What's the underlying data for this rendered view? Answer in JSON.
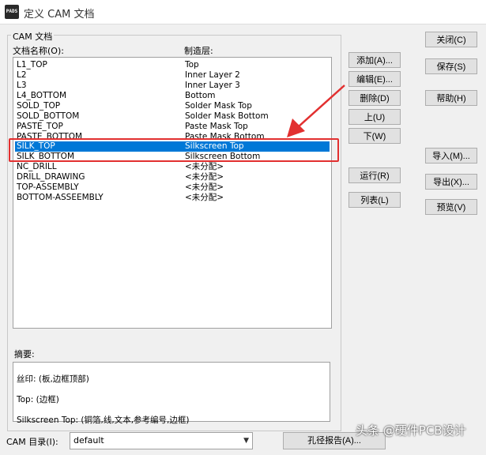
{
  "window": {
    "icon_text": "PADS",
    "title": "定义 CAM 文档"
  },
  "group": {
    "title": "CAM 文档"
  },
  "list": {
    "col_name_header": "文档名称(O):",
    "col_layer_header": "制造层:",
    "rows": [
      {
        "name": "L1_TOP",
        "layer": "Top"
      },
      {
        "name": "L2",
        "layer": "Inner Layer 2"
      },
      {
        "name": "L3",
        "layer": "Inner Layer 3"
      },
      {
        "name": "L4_BOTTOM",
        "layer": "Bottom"
      },
      {
        "name": "SOLD_TOP",
        "layer": "Solder Mask Top"
      },
      {
        "name": "SOLD_BOTTOM",
        "layer": "Solder Mask Bottom"
      },
      {
        "name": "PASTE_TOP",
        "layer": "Paste Mask Top"
      },
      {
        "name": "PASTE_BOTTOM",
        "layer": "Paste Mask Bottom"
      },
      {
        "name": "SILK_TOP",
        "layer": "Silkscreen Top"
      },
      {
        "name": "SILK_BOTTOM",
        "layer": "Silkscreen Bottom"
      },
      {
        "name": "NC_DRILL",
        "layer": "<未分配>"
      },
      {
        "name": "DRILL_DRAWING",
        "layer": "<未分配>"
      },
      {
        "name": "TOP-ASSEMBLY",
        "layer": "<未分配>"
      },
      {
        "name": "BOTTOM-ASSEEMBLY",
        "layer": "<未分配>"
      }
    ],
    "selected_row": "SILK_TOP"
  },
  "buttons": {
    "add": "添加(A)...",
    "edit": "编辑(E)...",
    "delete": "删除(D)",
    "up": "上(U)",
    "down": "下(W)",
    "run": "运行(R)",
    "report": "列表(L)",
    "close": "关闭(C)",
    "save": "保存(S)",
    "help": "帮助(H)",
    "import": "导入(M)...",
    "export": "导出(X)...",
    "preview": "预览(V)",
    "drill_report": "孔径报告(A)..."
  },
  "summary": {
    "label": "摘要:",
    "lines": [
      "丝印: (板,边框顶部)",
      "Top: (边框)",
      "Silkscreen Top: (铜箔,线,文本,参考编号,边框)"
    ]
  },
  "cam_dir": {
    "label": "CAM 目录(I):",
    "value": "default"
  },
  "watermark": "头条 @硬件PCB设计",
  "colors": {
    "selection": "#0078d7",
    "annotation": "#e23030"
  }
}
